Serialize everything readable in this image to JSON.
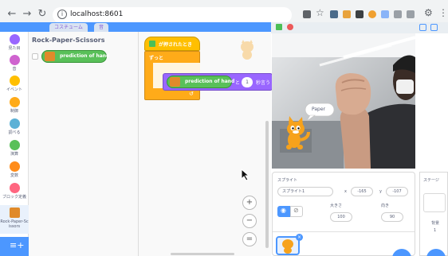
{
  "browser": {
    "url": "localhost:8601",
    "back_icon": "arrow-left-icon",
    "forward_icon": "arrow-right-icon",
    "reload_icon": "reload-icon"
  },
  "editor": {
    "tabs": [
      "コスチューム",
      "音"
    ]
  },
  "categories": [
    {
      "label": "見た目",
      "color": "#9966ff"
    },
    {
      "label": "音",
      "color": "#cf63cf"
    },
    {
      "label": "イベント",
      "color": "#ffbf00"
    },
    {
      "label": "制御",
      "color": "#ffab19"
    },
    {
      "label": "調べる",
      "color": "#5cb1d6"
    },
    {
      "label": "演算",
      "color": "#59c059"
    },
    {
      "label": "変数",
      "color": "#ff8c1a"
    },
    {
      "label": "ブロック定義",
      "color": "#ff6680"
    },
    {
      "label": "Rock-Paper-Scissors",
      "color": "#e08a2a"
    }
  ],
  "palette": {
    "section_title": "Rock-Paper-Scissors",
    "reporter_label": "prediction of hand"
  },
  "workspace": {
    "hat_label": "が押されたとき",
    "forever_label": "ずっと",
    "say_reporter": "prediction of hand",
    "say_seconds": "1",
    "say_suffix": "秒言う",
    "zoom_in": "+",
    "zoom_out": "−",
    "zoom_reset": "="
  },
  "stage": {
    "speech": "Paper"
  },
  "sprite_info": {
    "section_label": "スプライト",
    "name_value": "スプライト1",
    "x_label": "x",
    "x_value": "-165",
    "y_label": "y",
    "y_value": "-107",
    "size_label": "大きさ",
    "size_value": "100",
    "direction_label": "向き",
    "direction_value": "90"
  },
  "stage_panel": {
    "label": "ステージ",
    "backdrops_label": "背景",
    "backdrops_count": "1"
  },
  "colors": {
    "scratch_blue": "#4c97ff",
    "events_yellow": "#ffbf00",
    "extension_green": "#59c059",
    "control_orange": "#ffab19"
  }
}
